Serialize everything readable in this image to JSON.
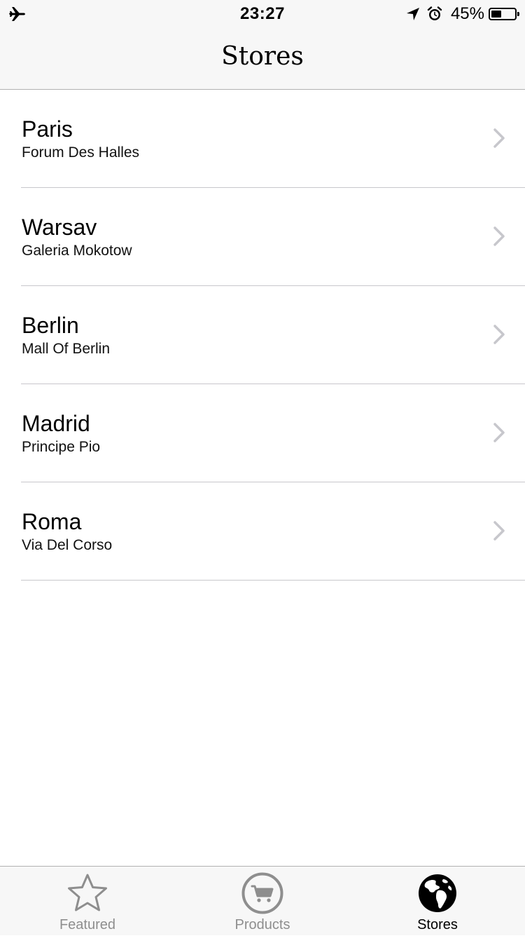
{
  "status_bar": {
    "time": "23:27",
    "battery_percent_text": "45%",
    "battery_level": 0.45,
    "icons": [
      "airplane-icon",
      "location-arrow-icon",
      "alarm-icon",
      "battery-icon"
    ]
  },
  "nav": {
    "title": "Stores"
  },
  "stores": [
    {
      "city": "Paris",
      "mall": "Forum Des Halles"
    },
    {
      "city": "Warsav",
      "mall": "Galeria Mokotow"
    },
    {
      "city": "Berlin",
      "mall": "Mall Of Berlin"
    },
    {
      "city": "Madrid",
      "mall": "Principe Pio"
    },
    {
      "city": "Roma",
      "mall": "Via Del Corso"
    }
  ],
  "tabs": [
    {
      "label": "Featured",
      "icon": "star-icon",
      "active": false
    },
    {
      "label": "Products",
      "icon": "cart-icon",
      "active": false
    },
    {
      "label": "Stores",
      "icon": "globe-icon",
      "active": true
    }
  ],
  "colors": {
    "bar_background": "#f7f7f7",
    "separator": "#c8c7cc",
    "inactive_tab": "#8e8e8e",
    "active_tab": "#000000",
    "chevron": "#c7c7cc"
  }
}
